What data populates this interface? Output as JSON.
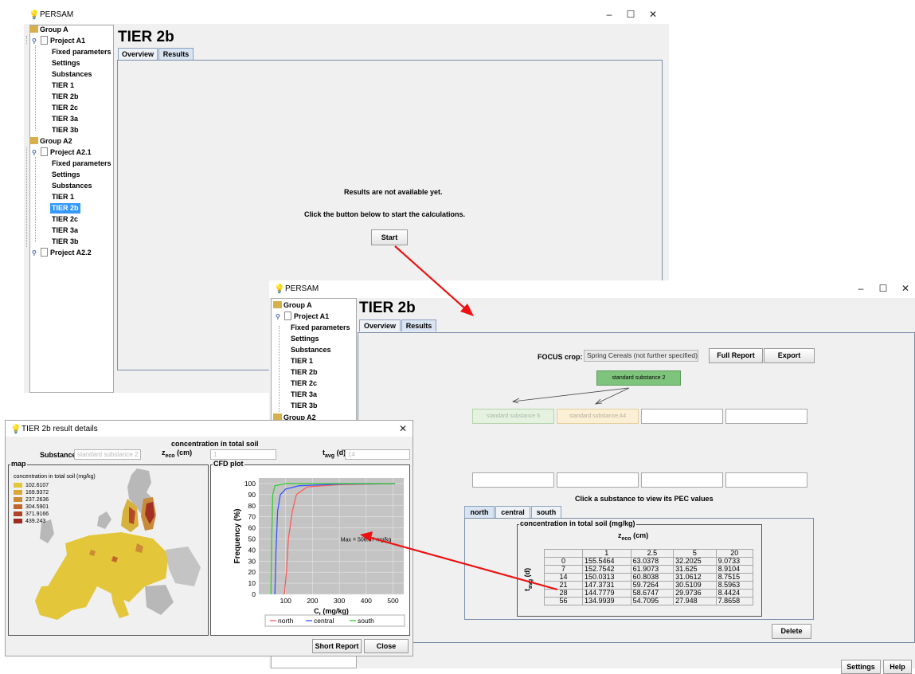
{
  "app_title": "PERSAM",
  "window_controls": {
    "minimize": "–",
    "maximize": "☐",
    "close": "✕"
  },
  "page_title": "TIER 2b",
  "tabs": {
    "overview": "Overview",
    "results": "Results"
  },
  "tree_back": {
    "group_a": "Group A",
    "project_a1": "Project A1",
    "a1_items": [
      "Fixed parameters",
      "Settings",
      "Substances",
      "TIER 1",
      "TIER 2b",
      "TIER 2c",
      "TIER 3a",
      "TIER 3b"
    ],
    "group_a2": "Group A2",
    "project_a21": "Project A2.1",
    "a21_items": [
      "Fixed parameters",
      "Settings",
      "Substances",
      "TIER 1",
      "TIER 2b",
      "TIER 2c",
      "TIER 3a",
      "TIER 3b"
    ],
    "project_a22": "Project A2.2"
  },
  "back_window": {
    "msg1": "Results are not available yet.",
    "msg2": "Click the button below to start the calculations.",
    "start_button": "Start"
  },
  "tree_front": {
    "group_a": "Group A",
    "project_a1": "Project A1",
    "a1_items": [
      "Fixed parameters",
      "Settings",
      "Substances",
      "TIER 1",
      "TIER 2b",
      "TIER 2c",
      "TIER 3a",
      "TIER 3b"
    ],
    "group_a2": "Group A2"
  },
  "front_window": {
    "focus_crop_label": "FOCUS crop:",
    "focus_crop_value": "Spring Cereals (not further specified)",
    "full_report_button": "Full Report",
    "export_button": "Export",
    "parent_substance": "standard substance 2",
    "metabolite_1": "standard substance 5",
    "metabolite_2": "standard substance A4",
    "click_hint": "Click a substance to view its PEC values",
    "zone_tabs": [
      "north",
      "central",
      "south"
    ],
    "table_title": "concentration in total soil (mg/kg)",
    "zeco_header": "z",
    "zeco_sub": "eco",
    "zeco_unit": "(cm)",
    "tavg_label": "t",
    "tavg_sub": "avg",
    "tavg_unit": "(d)",
    "columns": [
      "1",
      "2.5",
      "5",
      "20"
    ],
    "rows": [
      [
        "0",
        "155.5464",
        "63.0378",
        "32.2025",
        "9.0733"
      ],
      [
        "7",
        "152.7542",
        "61.9073",
        "31.625",
        "8.9104"
      ],
      [
        "14",
        "150.0313",
        "60.8038",
        "31.0612",
        "8.7515"
      ],
      [
        "21",
        "147.3731",
        "59.7264",
        "30.5109",
        "8.5963"
      ],
      [
        "28",
        "144.7779",
        "58.6747",
        "29.9736",
        "8.4424"
      ],
      [
        "56",
        "134.9939",
        "54.7095",
        "27.948",
        "7.8658"
      ]
    ],
    "delete_button": "Delete",
    "settings_button": "Settings",
    "help_button": "Help"
  },
  "details_dialog": {
    "title": "TIER 2b result details",
    "heading": "concentration in total soil",
    "substance_label": "Substance:",
    "substance_value": "standard substance 2",
    "zeco_label": "z",
    "zeco_sub": "eco",
    "zeco_unit": "(cm)",
    "zeco_value": "1",
    "tavg_label": "t",
    "tavg_sub": "avg",
    "tavg_unit": "(d)",
    "tavg_value": "14",
    "map_group": "map",
    "map_legend_title": "concentration in total soil (mg/kg)",
    "map_legend": [
      {
        "label": "102.6107",
        "color": "#e3c63a"
      },
      {
        "label": "169.9372",
        "color": "#d8a83a"
      },
      {
        "label": "237.2636",
        "color": "#cc8a34"
      },
      {
        "label": "304.5901",
        "color": "#c0662d"
      },
      {
        "label": "371.9166",
        "color": "#b04426"
      },
      {
        "label": "439.243",
        "color": "#9e2a20"
      }
    ],
    "cfd_group": "CFD plot",
    "max_annotation": "Max = 506.57 mg/kg",
    "short_report_button": "Short Report",
    "close_button": "Close"
  },
  "chart_data": {
    "type": "line",
    "ylabel": "Frequency (%)",
    "xlabel": "C",
    "xlabel_sub": "t",
    "xlabel_unit": "(mg/kg)",
    "xlim": [
      0,
      540
    ],
    "ylim": [
      0,
      105
    ],
    "xticks": [
      100,
      200,
      300,
      400,
      500
    ],
    "yticks": [
      0,
      10,
      20,
      30,
      40,
      50,
      60,
      70,
      80,
      90,
      100
    ],
    "series": [
      {
        "name": "north",
        "color": "#ff5a5a",
        "points": [
          [
            95,
            0
          ],
          [
            103,
            20
          ],
          [
            110,
            50
          ],
          [
            125,
            75
          ],
          [
            140,
            90
          ],
          [
            180,
            97
          ],
          [
            300,
            99
          ],
          [
            507,
            100
          ]
        ]
      },
      {
        "name": "central",
        "color": "#3355ff",
        "points": [
          [
            60,
            0
          ],
          [
            64,
            40
          ],
          [
            70,
            75
          ],
          [
            80,
            90
          ],
          [
            100,
            95
          ],
          [
            150,
            98
          ],
          [
            300,
            99.5
          ],
          [
            507,
            100
          ]
        ]
      },
      {
        "name": "south",
        "color": "#33cc33",
        "points": [
          [
            45,
            0
          ],
          [
            48,
            50
          ],
          [
            52,
            90
          ],
          [
            60,
            98
          ],
          [
            100,
            100
          ],
          [
            507,
            100
          ]
        ]
      }
    ]
  },
  "colors": {
    "accent": "#3399ff",
    "parent_box": "#7fc47c",
    "metabolite_1": "#e4f2df",
    "metabolite_2": "#fbf0d6",
    "arrow": "#ee1111"
  }
}
